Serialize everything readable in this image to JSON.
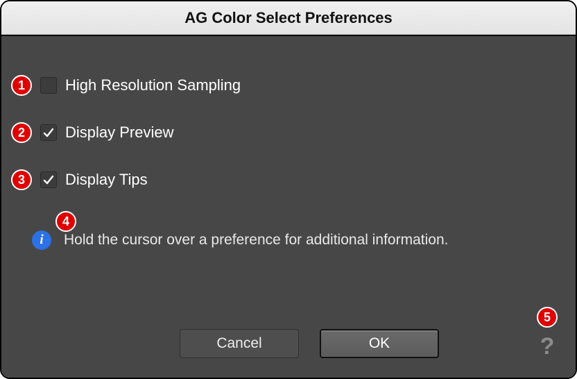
{
  "title": "AG Color Select Preferences",
  "options": [
    {
      "label": "High Resolution Sampling",
      "checked": false,
      "marker": "1"
    },
    {
      "label": "Display Preview",
      "checked": true,
      "marker": "2"
    },
    {
      "label": "Display Tips",
      "checked": true,
      "marker": "3"
    }
  ],
  "tip": {
    "marker": "4",
    "icon_glyph": "i",
    "text": "Hold the cursor over a preference for additional information."
  },
  "buttons": {
    "cancel": "Cancel",
    "ok": "OK"
  },
  "help": {
    "marker": "5",
    "glyph": "?"
  }
}
